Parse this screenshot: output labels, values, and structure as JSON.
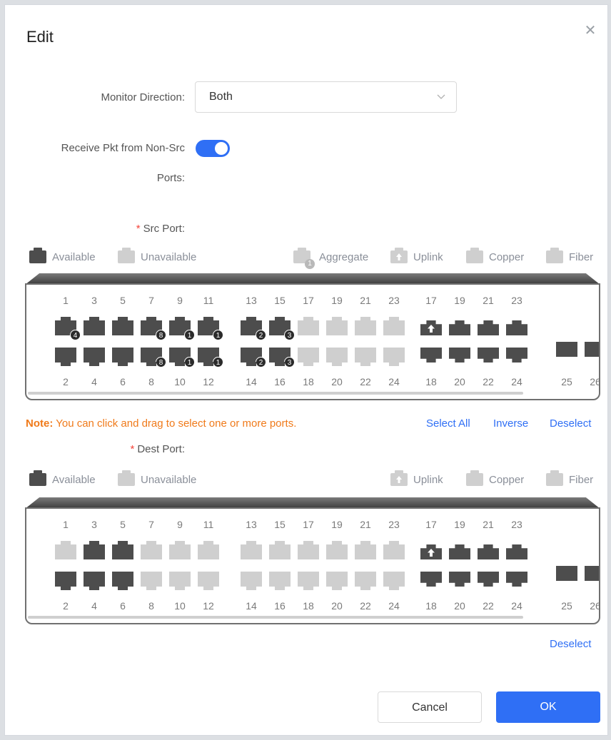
{
  "dialog": {
    "title": "Edit",
    "close_icon": "close-icon"
  },
  "form": {
    "monitor_direction_label": "Monitor Direction:",
    "monitor_direction_value": "Both",
    "receive_pkt_label_line1": "Receive Pkt from Non-Src",
    "receive_pkt_label_line2": "Ports:",
    "receive_pkt_enabled": true,
    "src_port_label": "Src Port:",
    "dest_port_label": "Dest Port:",
    "required_mark": "*"
  },
  "legend": {
    "available": "Available",
    "unavailable": "Unavailable",
    "aggregate": "Aggregate",
    "aggregate_badge": "1",
    "uplink": "Uplink",
    "copper": "Copper",
    "fiber": "Fiber"
  },
  "panel_labels": {
    "top": [
      "1",
      "3",
      "5",
      "7",
      "9",
      "11",
      "13",
      "15",
      "17",
      "19",
      "21",
      "23",
      "17",
      "19",
      "21",
      "23"
    ],
    "bottom": [
      "2",
      "4",
      "6",
      "8",
      "10",
      "12",
      "14",
      "16",
      "18",
      "20",
      "22",
      "24",
      "18",
      "20",
      "22",
      "24",
      "25",
      "26"
    ]
  },
  "src_badges": {
    "top": [
      "4",
      "",
      "",
      "8",
      "1",
      "1",
      "2",
      "3"
    ],
    "bottom": [
      "",
      "",
      "",
      "8",
      "1",
      "1",
      "2",
      "3"
    ]
  },
  "note": {
    "prefix": "Note:",
    "text": " You can click and drag to select one or more ports."
  },
  "actions": {
    "select_all": "Select All",
    "inverse": "Inverse",
    "deselect": "Deselect",
    "deselect_dest": "Deselect"
  },
  "buttons": {
    "cancel": "Cancel",
    "ok": "OK"
  },
  "colors": {
    "accent": "#2f6ff5",
    "note": "#f07a1a",
    "required": "#f5463c",
    "port_dark": "#4d4d4d",
    "port_light": "#cfcfcf"
  }
}
